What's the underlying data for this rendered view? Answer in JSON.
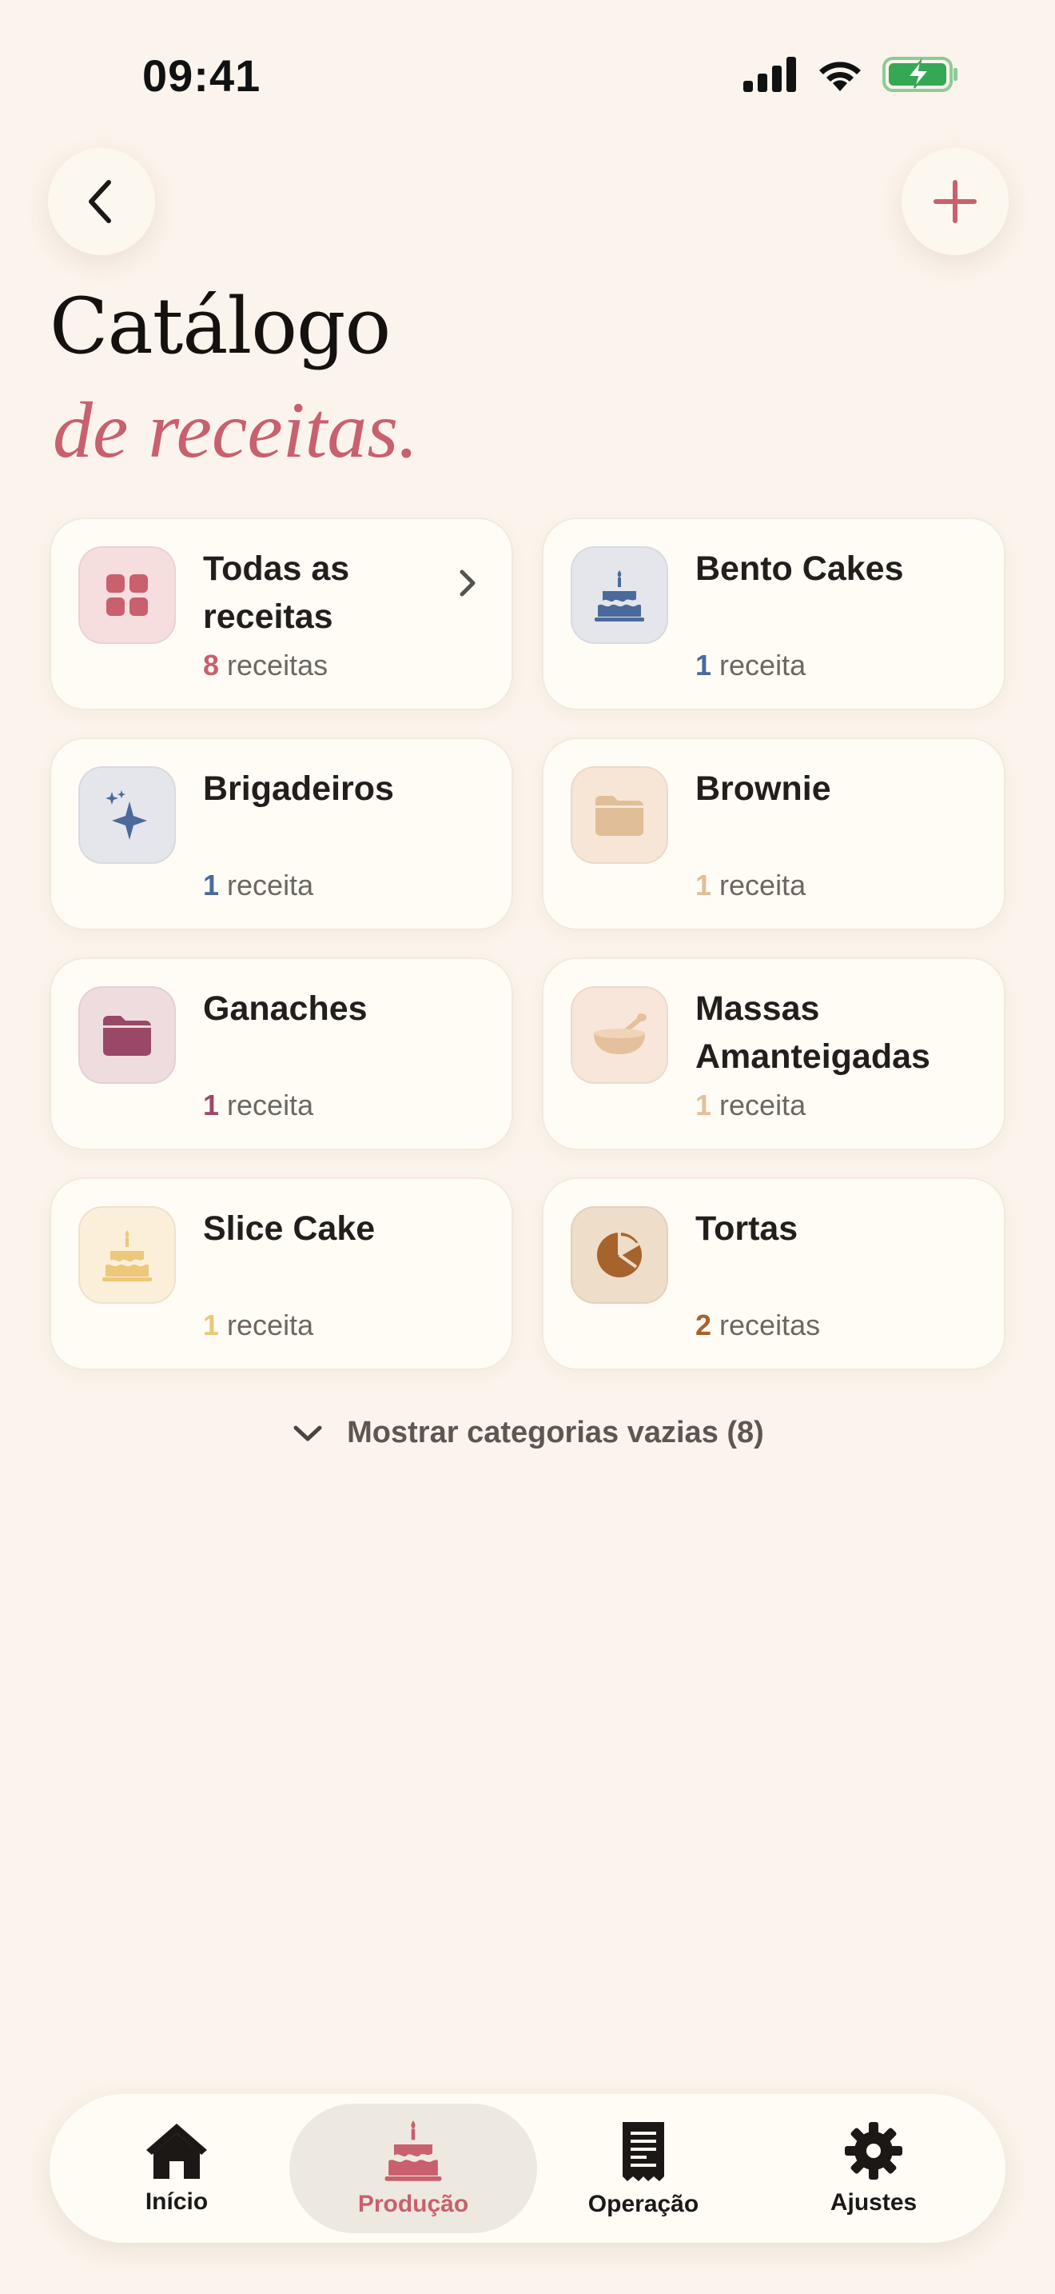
{
  "status_bar": {
    "time": "09:41"
  },
  "header": {
    "back_icon": "chevron-left-icon",
    "add_icon": "plus-icon",
    "title_line1": "Catálogo",
    "title_line2": "de receitas."
  },
  "categories": [
    {
      "name": "Todas as receitas",
      "count": "8",
      "unit": "receitas",
      "icon": "grid-icon",
      "accent": "#C8606E",
      "bg": "#F6DEDE",
      "has_chevron": true
    },
    {
      "name": "Bento Cakes",
      "count": "1",
      "unit": "receita",
      "icon": "cake-icon",
      "accent": "#4B6A9B",
      "bg": "#E4E6EC"
    },
    {
      "name": "Brigadeiros",
      "count": "1",
      "unit": "receita",
      "icon": "sparkles-icon",
      "accent": "#4B6A9B",
      "bg": "#E4E6EC"
    },
    {
      "name": "Brownie",
      "count": "1",
      "unit": "receita",
      "icon": "folder-icon",
      "accent": "#E0BE98",
      "bg": "#F7E6D6"
    },
    {
      "name": "Ganaches",
      "count": "1",
      "unit": "receita",
      "icon": "folder-icon",
      "accent": "#9A4868",
      "bg": "#EFDCDF"
    },
    {
      "name": "Massas Amanteigadas",
      "count": "1",
      "unit": "receita",
      "icon": "mixing-bowl-icon",
      "accent": "#E5C09C",
      "bg": "#F7E6D9"
    },
    {
      "name": "Slice Cake",
      "count": "1",
      "unit": "receita",
      "icon": "cake-icon",
      "accent": "#EDC77A",
      "bg": "#FBEFD9"
    },
    {
      "name": "Tortas",
      "count": "2",
      "unit": "receitas",
      "icon": "pie-chart-icon",
      "accent": "#A6642C",
      "bg": "#EEDDC9"
    }
  ],
  "show_empty": {
    "label": "Mostrar categorias vazias (8)"
  },
  "tabs": [
    {
      "label": "Início",
      "icon": "home-icon",
      "active": false
    },
    {
      "label": "Produção",
      "icon": "cake-icon",
      "active": true
    },
    {
      "label": "Operação",
      "icon": "receipt-icon",
      "active": false
    },
    {
      "label": "Ajustes",
      "icon": "gear-icon",
      "active": false
    }
  ],
  "colors": {
    "background": "#FBF4EC",
    "accent": "#C8606E",
    "card": "#FFFCF6"
  }
}
